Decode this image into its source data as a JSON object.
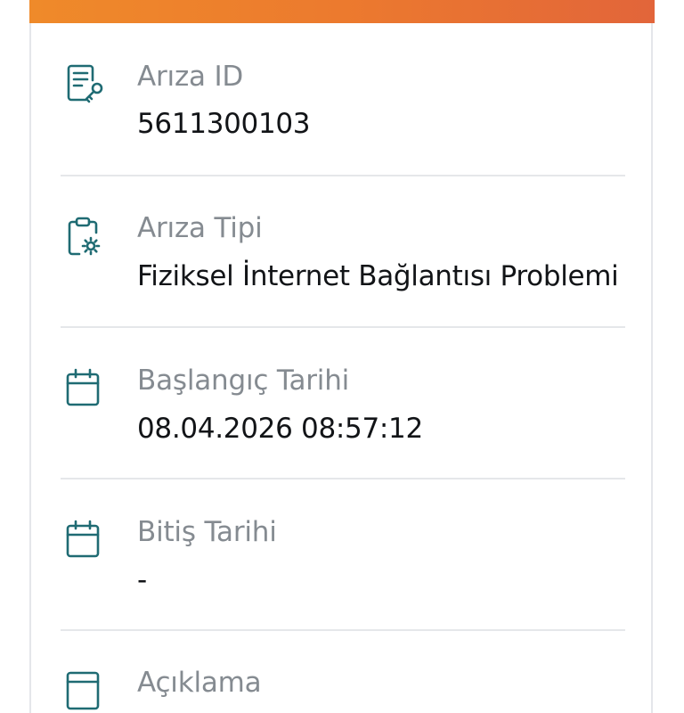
{
  "colors": {
    "header_gradient_start": "#ef8a2a",
    "header_gradient_end": "#e2653a",
    "icon": "#1f6b73",
    "label": "#858b91",
    "value": "#121417",
    "divider": "#e5e7ea"
  },
  "fields": [
    {
      "icon": "document-key-icon",
      "label": "Arıza ID",
      "value": "5611300103"
    },
    {
      "icon": "clipboard-gear-icon",
      "label": "Arıza Tipi",
      "value": "Fiziksel İnternet Bağlantısı Problemi"
    },
    {
      "icon": "calendar-icon",
      "label": "Başlangıç Tarihi",
      "value": "08.04.2026 08:57:12"
    },
    {
      "icon": "calendar-icon",
      "label": "Bitiş Tarihi",
      "value": "-"
    },
    {
      "icon": "notes-icon",
      "label": "Açıklama",
      "value": ""
    }
  ]
}
